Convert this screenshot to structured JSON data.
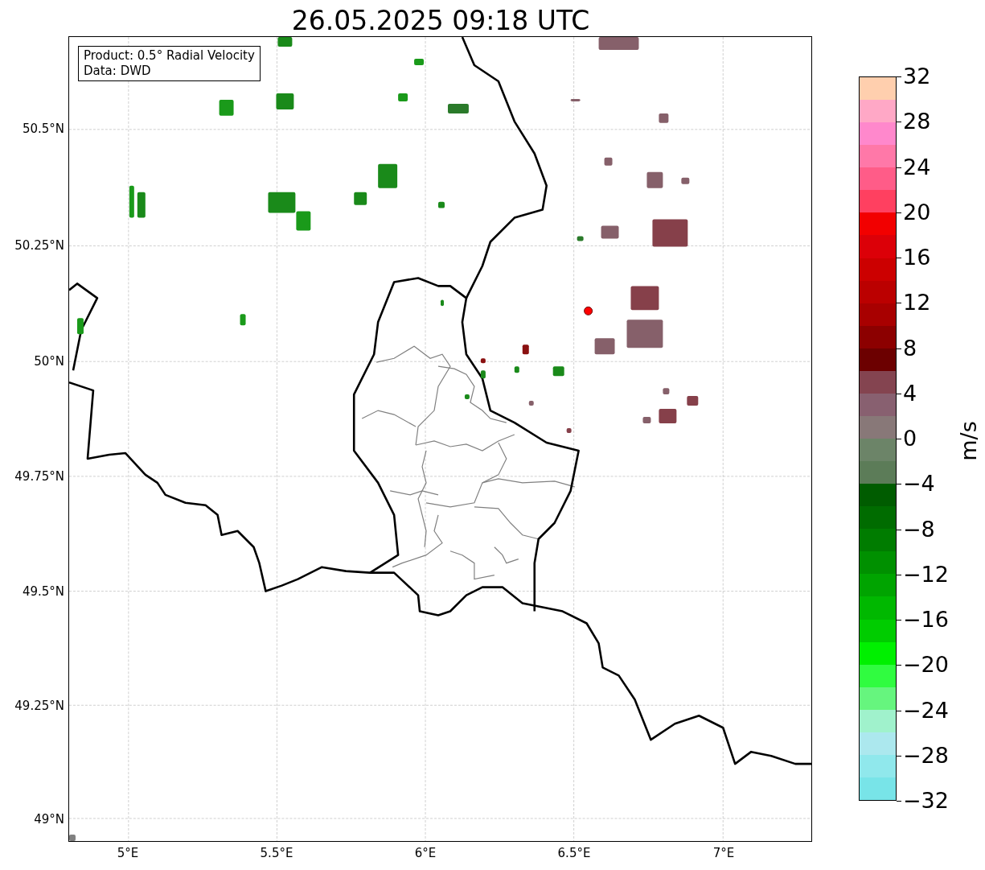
{
  "title": "26.05.2025 09:18 UTC",
  "legend": [
    "Product: 0.5° Radial Velocity",
    "Data: DWD"
  ],
  "map": {
    "x_ticks": [
      "5°E",
      "5.5°E",
      "6°E",
      "6.5°E",
      "7°E"
    ],
    "y_ticks": [
      "50.5°N",
      "50.25°N",
      "50°N",
      "49.75°N",
      "49.5°N",
      "49.25°N",
      "49°N"
    ]
  },
  "colorbar": {
    "label": "m/s",
    "ticks": [
      "32",
      "28",
      "24",
      "20",
      "16",
      "12",
      "8",
      "4",
      "0",
      "−4",
      "−8",
      "−12",
      "−16",
      "−20",
      "−24",
      "−28",
      "−32"
    ],
    "segments": [
      {
        "color": "#ffcfae"
      },
      {
        "color": "#ffa8c6"
      },
      {
        "color": "#ff88cc"
      },
      {
        "color": "#ff78a8"
      },
      {
        "color": "#ff5c88"
      },
      {
        "color": "#ff4060"
      },
      {
        "color": "#f20000"
      },
      {
        "color": "#dc0008"
      },
      {
        "color": "#cc0000"
      },
      {
        "color": "#bb0000"
      },
      {
        "color": "#a80000"
      },
      {
        "color": "#8c0000"
      },
      {
        "color": "#6c0000"
      },
      {
        "color": "#844450"
      },
      {
        "color": "#886070"
      },
      {
        "color": "#887878"
      },
      {
        "color": "#6c8468"
      },
      {
        "color": "#5c7c58"
      },
      {
        "color": "#005c00"
      },
      {
        "color": "#006c00"
      },
      {
        "color": "#007c00"
      },
      {
        "color": "#009000"
      },
      {
        "color": "#00a400"
      },
      {
        "color": "#00b800"
      },
      {
        "color": "#00cc00"
      },
      {
        "color": "#00f000"
      },
      {
        "color": "#30fc40"
      },
      {
        "color": "#66f57e"
      },
      {
        "color": "#a0f2cc"
      },
      {
        "color": "#ace8ee"
      },
      {
        "color": "#90e8ec"
      },
      {
        "color": "#78e4e8"
      }
    ]
  }
}
